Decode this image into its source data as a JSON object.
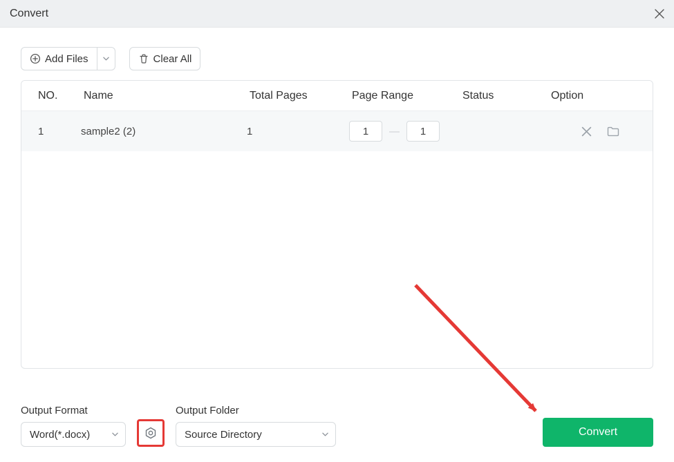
{
  "window": {
    "title": "Convert"
  },
  "toolbar": {
    "add_files_label": "Add Files",
    "clear_all_label": "Clear All"
  },
  "table": {
    "headers": {
      "no": "NO.",
      "name": "Name",
      "total_pages": "Total Pages",
      "page_range": "Page Range",
      "status": "Status",
      "option": "Option"
    },
    "rows": [
      {
        "no": "1",
        "name": "sample2 (2)",
        "total_pages": "1",
        "range_from": "1",
        "range_to": "1",
        "status": ""
      }
    ]
  },
  "footer": {
    "format_label": "Output Format",
    "format_value": "Word(*.docx)",
    "folder_label": "Output Folder",
    "folder_value": "Source Directory",
    "convert_label": "Convert"
  },
  "icons": {
    "add": "plus-circle-icon",
    "clear": "trash-icon",
    "settings": "gear-icon"
  },
  "annotation": {
    "arrow_color": "#e53935",
    "highlight_element": "settings-button"
  }
}
